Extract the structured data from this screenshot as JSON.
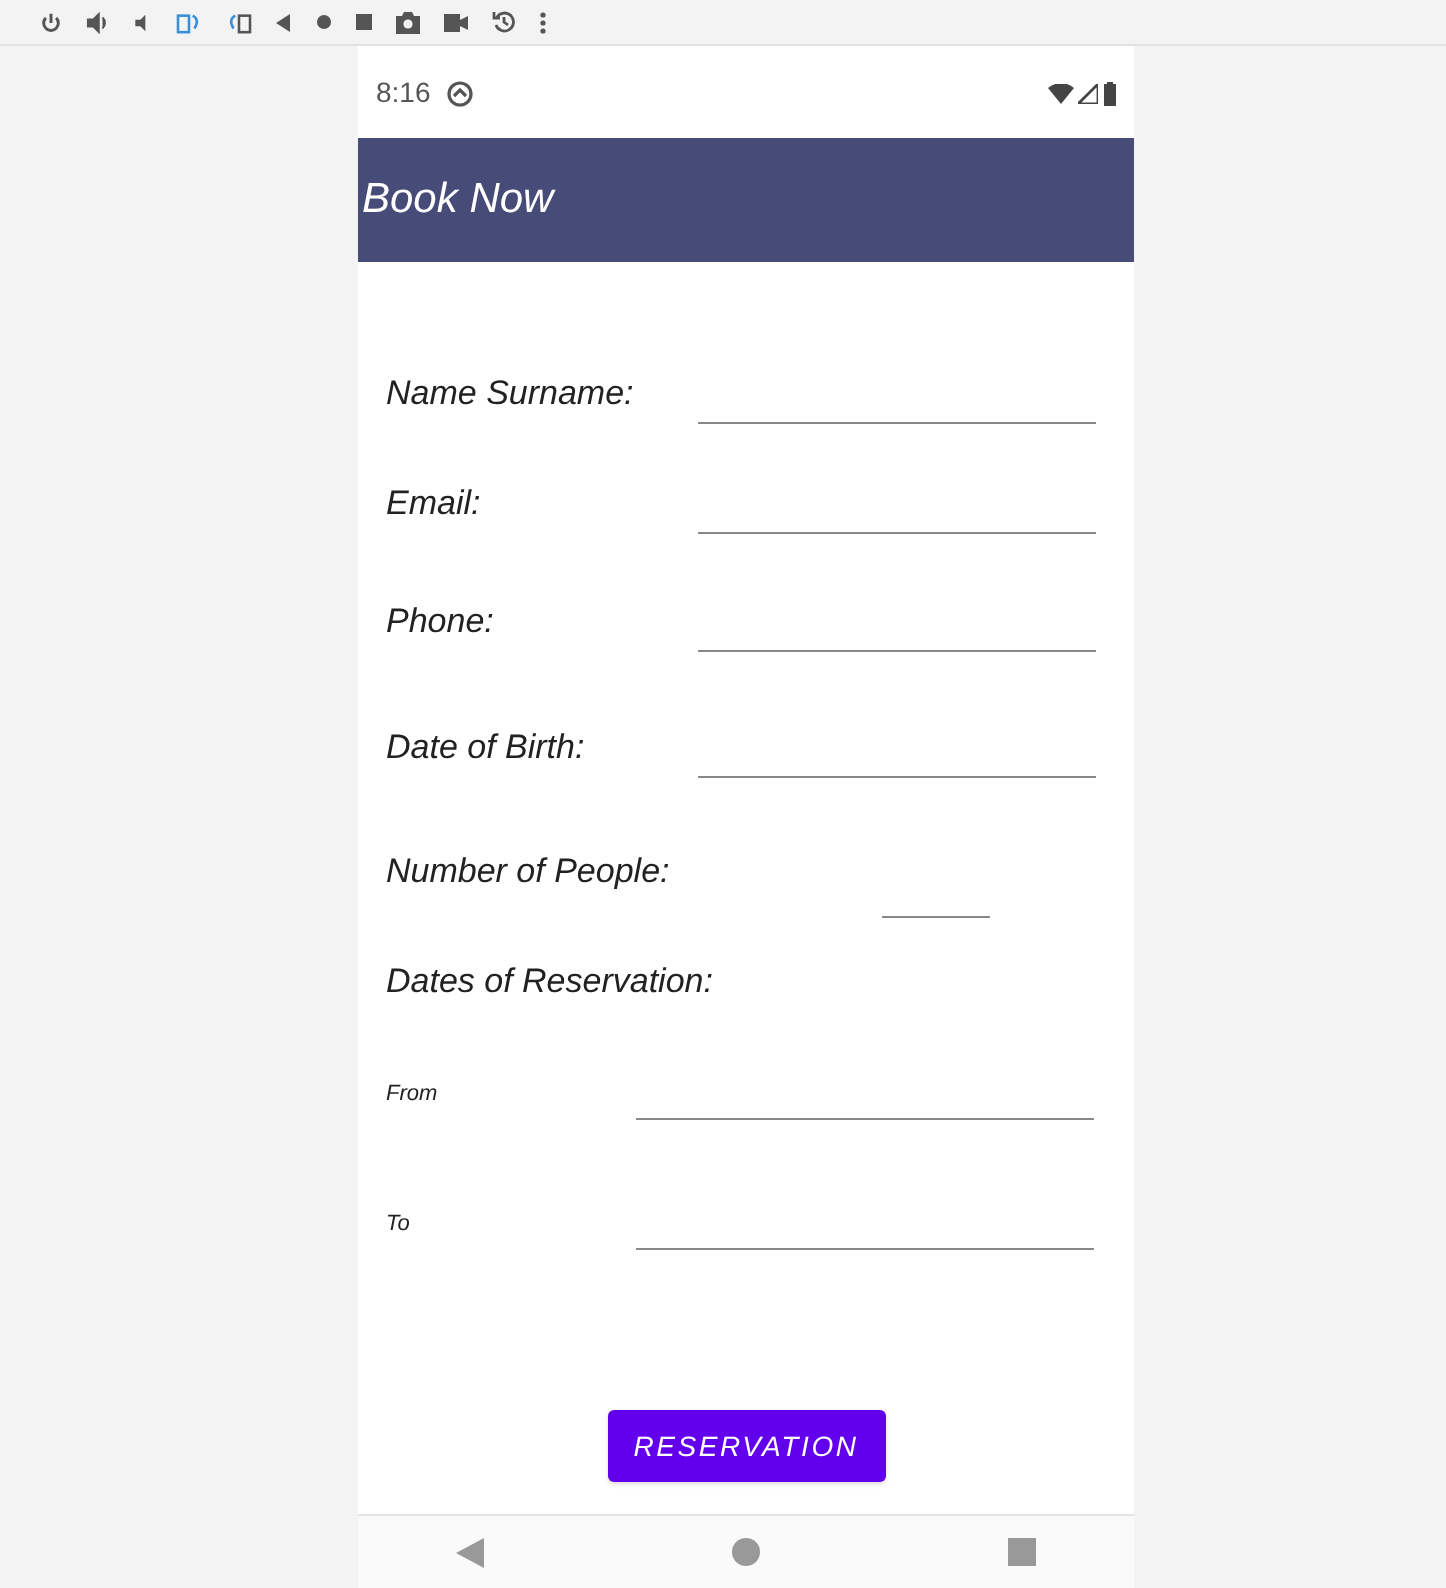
{
  "status_bar": {
    "time": "8:16"
  },
  "app_bar": {
    "title": "Book Now"
  },
  "fields": [
    {
      "label": "Name Surname:",
      "kind": "wide"
    },
    {
      "label": "Email:",
      "kind": "wide"
    },
    {
      "label": "Phone:",
      "kind": "wide"
    },
    {
      "label": "Date of Birth:",
      "kind": "wide"
    },
    {
      "label": "Number of People:",
      "kind": "short"
    }
  ],
  "reservation": {
    "heading": "Dates of Reservation:",
    "fields": [
      {
        "label": "From"
      },
      {
        "label": "To"
      }
    ]
  },
  "button": {
    "label": "RESERVATION"
  }
}
